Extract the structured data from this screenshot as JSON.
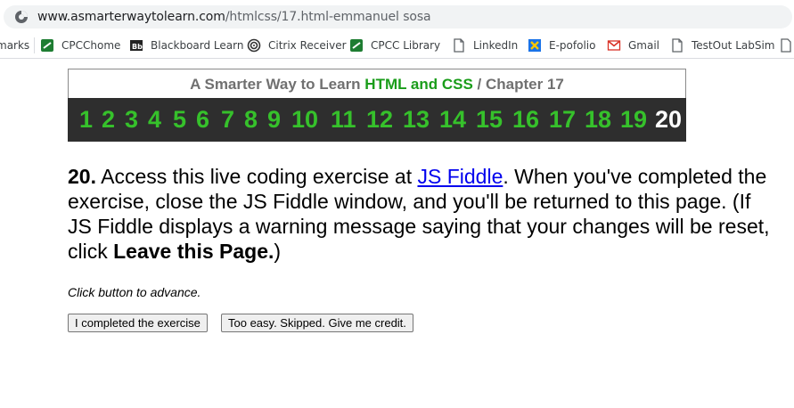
{
  "browser": {
    "url_host": "www.asmarterwaytolearn.com",
    "url_path": "/htmlcss/17.html-emmanuel sosa"
  },
  "bookmarks": [
    {
      "label": "marks",
      "icon": "bookmarks-star-icon"
    },
    {
      "label": "CPCChome",
      "icon": "link-icon"
    },
    {
      "label": "Blackboard Learn",
      "icon": "blackboard-icon"
    },
    {
      "label": "Citrix Receiver",
      "icon": "citrix-icon"
    },
    {
      "label": "CPCC Library",
      "icon": "link-icon"
    },
    {
      "label": "LinkedIn",
      "icon": "page-icon"
    },
    {
      "label": "E-pofolio",
      "icon": "x-app-icon"
    },
    {
      "label": "Gmail",
      "icon": "gmail-icon"
    },
    {
      "label": "TestOut LabSim",
      "icon": "page-icon"
    }
  ],
  "header": {
    "title_prefix": "A Smarter Way to Learn ",
    "title_highlight": "HTML and CSS",
    "title_suffix": " / Chapter 17",
    "chapter_numbers": [
      "1",
      "2",
      "3",
      "4",
      "5",
      "6",
      "7",
      "8",
      "9",
      "10",
      "11",
      "12",
      "13",
      "14",
      "15",
      "16",
      "17",
      "18",
      "19",
      "20"
    ],
    "current": "20"
  },
  "exercise": {
    "number": "20.",
    "text_before_link": " Access this live coding exercise at ",
    "link_text": "JS Fiddle",
    "text_after_link": ". When you've completed the exercise, close the JS Fiddle window, and you'll be returned to this page. (If JS Fiddle displays a warning message saying that your changes will be reset, click ",
    "bold_action": "Leave this Page.",
    "closing": ")"
  },
  "advance_note": "Click button to advance.",
  "buttons": {
    "completed": "I completed the exercise",
    "skipped": "Too easy. Skipped. Give me credit."
  },
  "colors": {
    "nav_bg": "#2e2e2e",
    "nav_number": "#36c12b",
    "current_number": "#ffffff",
    "title_highlight": "#1a9d1a",
    "link": "#0000ee"
  }
}
